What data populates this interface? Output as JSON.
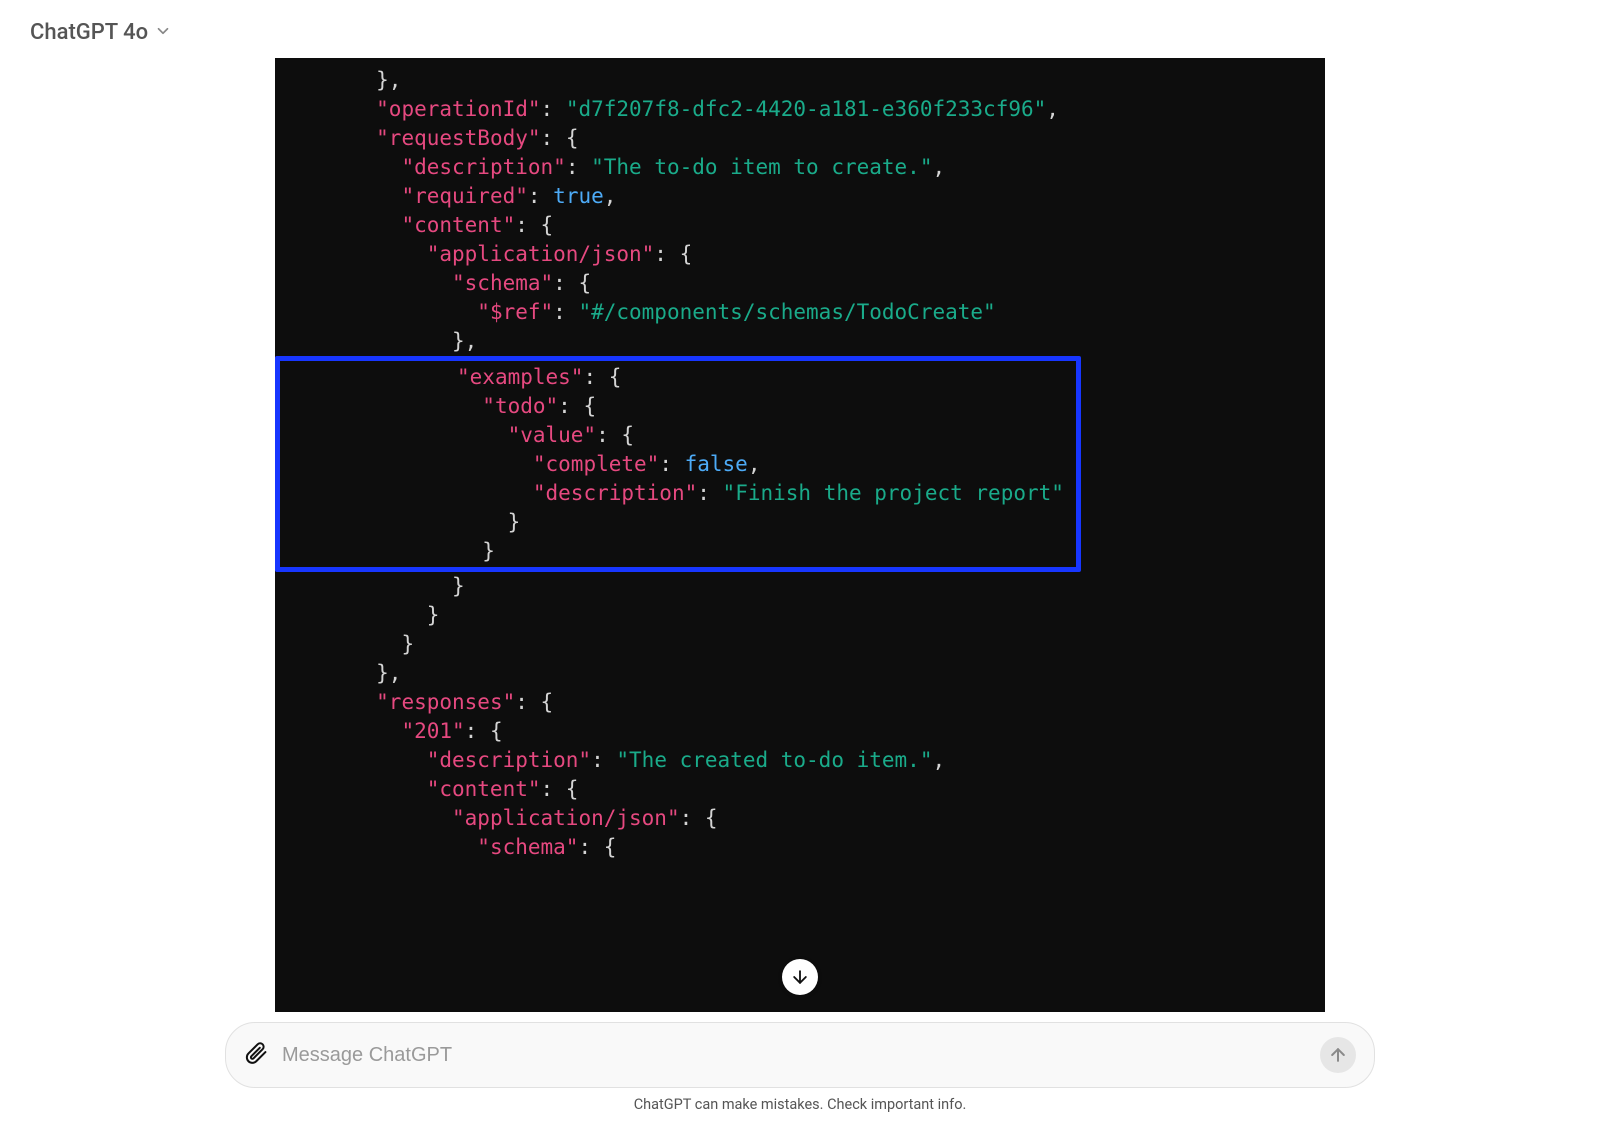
{
  "header": {
    "model_label": "ChatGPT 4o"
  },
  "code": {
    "indent": "        },",
    "operationId_key": "\"operationId\"",
    "operationId_val": "\"d7f207f8-dfc2-4420-a181-e360f233cf96\"",
    "requestBody_key": "\"requestBody\"",
    "description_key": "\"description\"",
    "description_val": "\"The to-do item to create.\"",
    "required_key": "\"required\"",
    "required_val": "true",
    "content_key": "\"content\"",
    "appjson_key": "\"application/json\"",
    "schema_key": "\"schema\"",
    "ref_key": "\"$ref\"",
    "ref_val": "\"#/components/schemas/TodoCreate\"",
    "examples_key": "\"examples\"",
    "todo_key": "\"todo\"",
    "value_key": "\"value\"",
    "complete_key": "\"complete\"",
    "complete_val": "false",
    "ex_description_key": "\"description\"",
    "ex_description_val": "\"Finish the project report\"",
    "responses_key": "\"responses\"",
    "r201_key": "\"201\"",
    "r201_desc_val": "\"The created to-do item.\""
  },
  "footer": {
    "placeholder": "Message ChatGPT",
    "disclaimer": "ChatGPT can make mistakes. Check important info."
  }
}
